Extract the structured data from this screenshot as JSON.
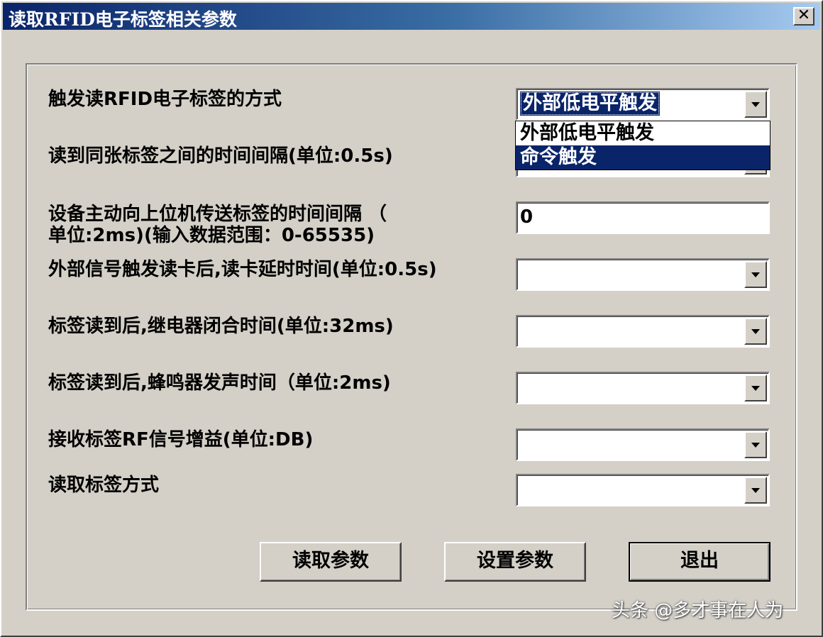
{
  "window": {
    "title": "读取RFID电子标签相关参数",
    "close_label": "✕"
  },
  "fields": [
    {
      "label": "触发读RFID电子标签的方式",
      "value": "外部低电平触发"
    },
    {
      "label": "读到同张标签之间的时间间隔(单位:0.5s)",
      "value": ""
    },
    {
      "label_line1": "设备主动向上位机传送标签的时间间隔 （",
      "label_line2": "单位:2ms)(输入数据范围：0-65535)",
      "value": "0"
    },
    {
      "label": "外部信号触发读卡后,读卡延时时间(单位:0.5s)",
      "value": ""
    },
    {
      "label": "标签读到后,继电器闭合时间(单位:32ms)",
      "value": ""
    },
    {
      "label": "标签读到后,蜂鸣器发声时间（单位:2ms)",
      "value": ""
    },
    {
      "label": "接收标签RF信号增益(单位:DB)",
      "value": ""
    },
    {
      "label": "读取标签方式",
      "value": ""
    }
  ],
  "dropdown": {
    "items": [
      "外部低电平触发",
      "命令触发"
    ],
    "highlighted": "命令触发"
  },
  "buttons": {
    "read": "读取参数",
    "set": "设置参数",
    "exit": "退出"
  },
  "watermark": "头条 @多才事在人为"
}
